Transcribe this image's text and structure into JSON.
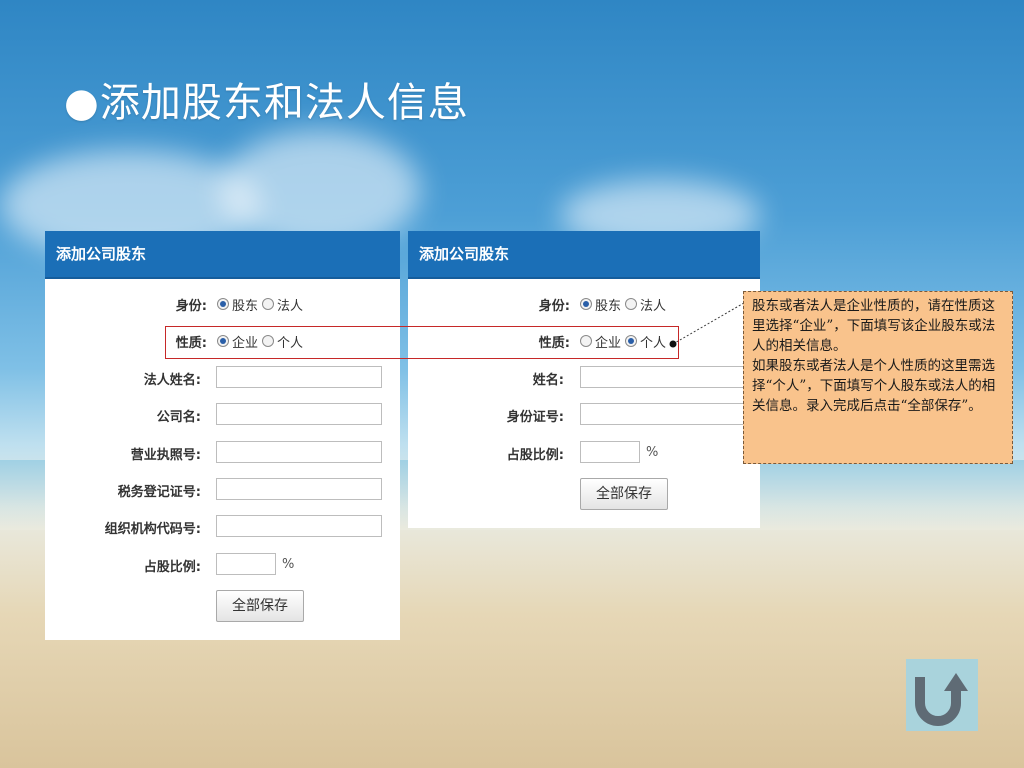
{
  "slide": {
    "title": "●添加股东和法人信息"
  },
  "left_panel": {
    "header": "添加公司股东",
    "identity_label": "身份:",
    "identity_options": [
      "股东",
      "法人"
    ],
    "nature_label": "性质:",
    "nature_options": [
      "企业",
      "个人"
    ],
    "fields": [
      "法人姓名:",
      "公司名:",
      "营业执照号:",
      "税务登记证号:",
      "组织机构代码号:"
    ],
    "share_label": "占股比例:",
    "percent": "%",
    "save_button": "全部保存"
  },
  "right_panel": {
    "header": "添加公司股东",
    "identity_label": "身份:",
    "identity_options": [
      "股东",
      "法人"
    ],
    "nature_label": "性质:",
    "nature_options": [
      "企业",
      "个人"
    ],
    "fields": [
      "姓名:",
      "身份证号:"
    ],
    "share_label": "占股比例:",
    "percent": "%",
    "save_button": "全部保存"
  },
  "note": {
    "text1": "股东或者法人是企业性质的，请在性质这里选择“企业”，下面填写该企业股东或法人的相关信息。",
    "text2": "如果股东或者法人是个人性质的这里需选择“个人”，下面填写个人股东或法人的相关信息。录入完成后点击“全部保存”。"
  },
  "icons": {
    "back": "return-arrow-icon"
  },
  "colors": {
    "header": "#1b6fb7",
    "note_bg": "#f9c38c",
    "highlight": "#c62828"
  }
}
